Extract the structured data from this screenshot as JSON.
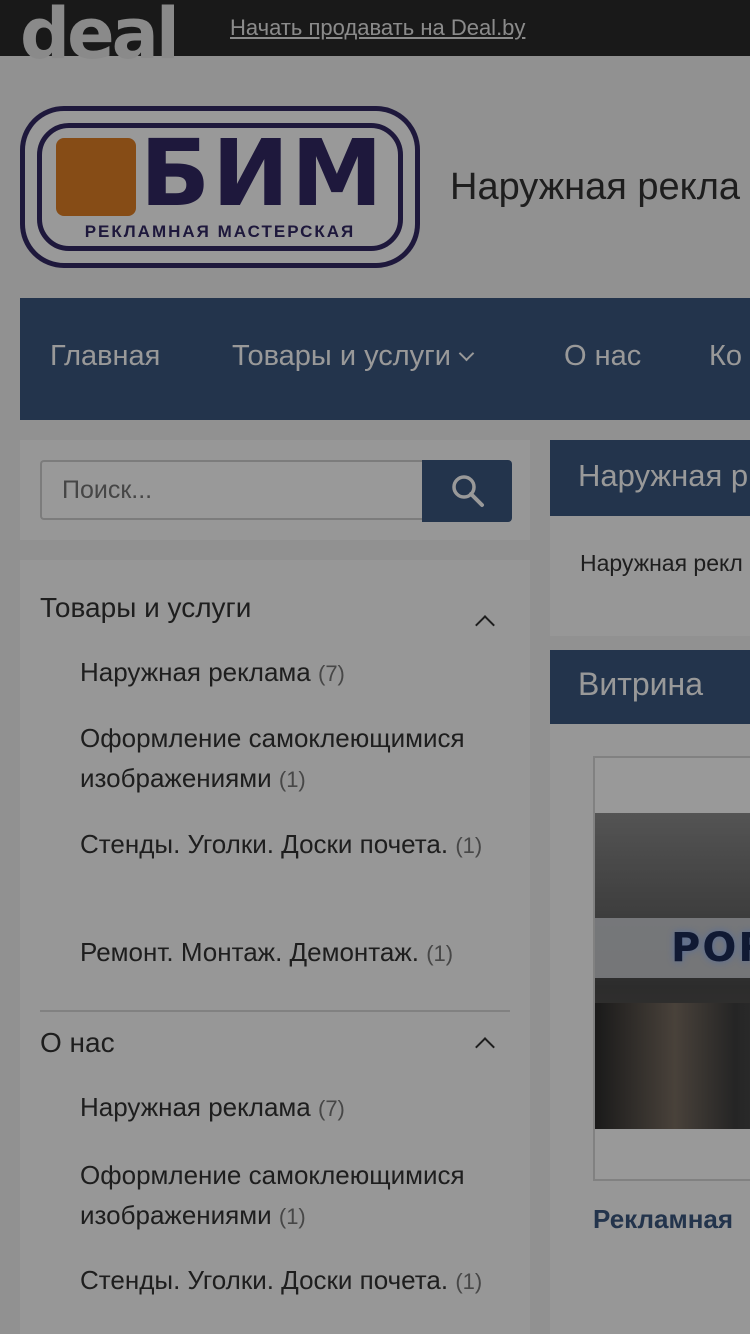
{
  "topbar": {
    "brand": "deal",
    "sell_link": "Начать продавать на Deal.by"
  },
  "logo": {
    "title": "БИМ",
    "subtitle": "РЕКЛАМНАЯ МАСТЕРСКАЯ"
  },
  "site_title": "Наружная рекла",
  "nav": {
    "items": [
      "Главная",
      "Товары и услуги",
      "О нас",
      "Ко"
    ]
  },
  "search": {
    "placeholder": "Поиск..."
  },
  "sidebar": {
    "sections": [
      {
        "title": "Товары и услуги",
        "items": [
          {
            "label": "Наружная реклама",
            "count": "(7)"
          },
          {
            "label": "Оформление самоклеющимися изображениями",
            "count": "(1)"
          },
          {
            "label": "Стенды. Уголки. Доски почета.",
            "count": "(1)"
          },
          {
            "label": "Ремонт. Монтаж. Демонтаж.",
            "count": "(1)"
          }
        ]
      },
      {
        "title": "О нас",
        "items": [
          {
            "label": "Наружная реклама",
            "count": "(7)"
          },
          {
            "label": "Оформление самоклеющимися изображениями",
            "count": "(1)"
          },
          {
            "label": "Стенды. Уголки. Доски почета.",
            "count": "(1)"
          }
        ]
      }
    ]
  },
  "content": {
    "heading": "Наружная р",
    "text": "Наружная рекл реклама, отде",
    "showcase_heading": "Витрина",
    "product": {
      "sign": "POR",
      "title": "Рекламная"
    }
  },
  "colors": {
    "navy": "#3b577f",
    "logo_navy": "#322864",
    "logo_orange": "#e07f26"
  }
}
